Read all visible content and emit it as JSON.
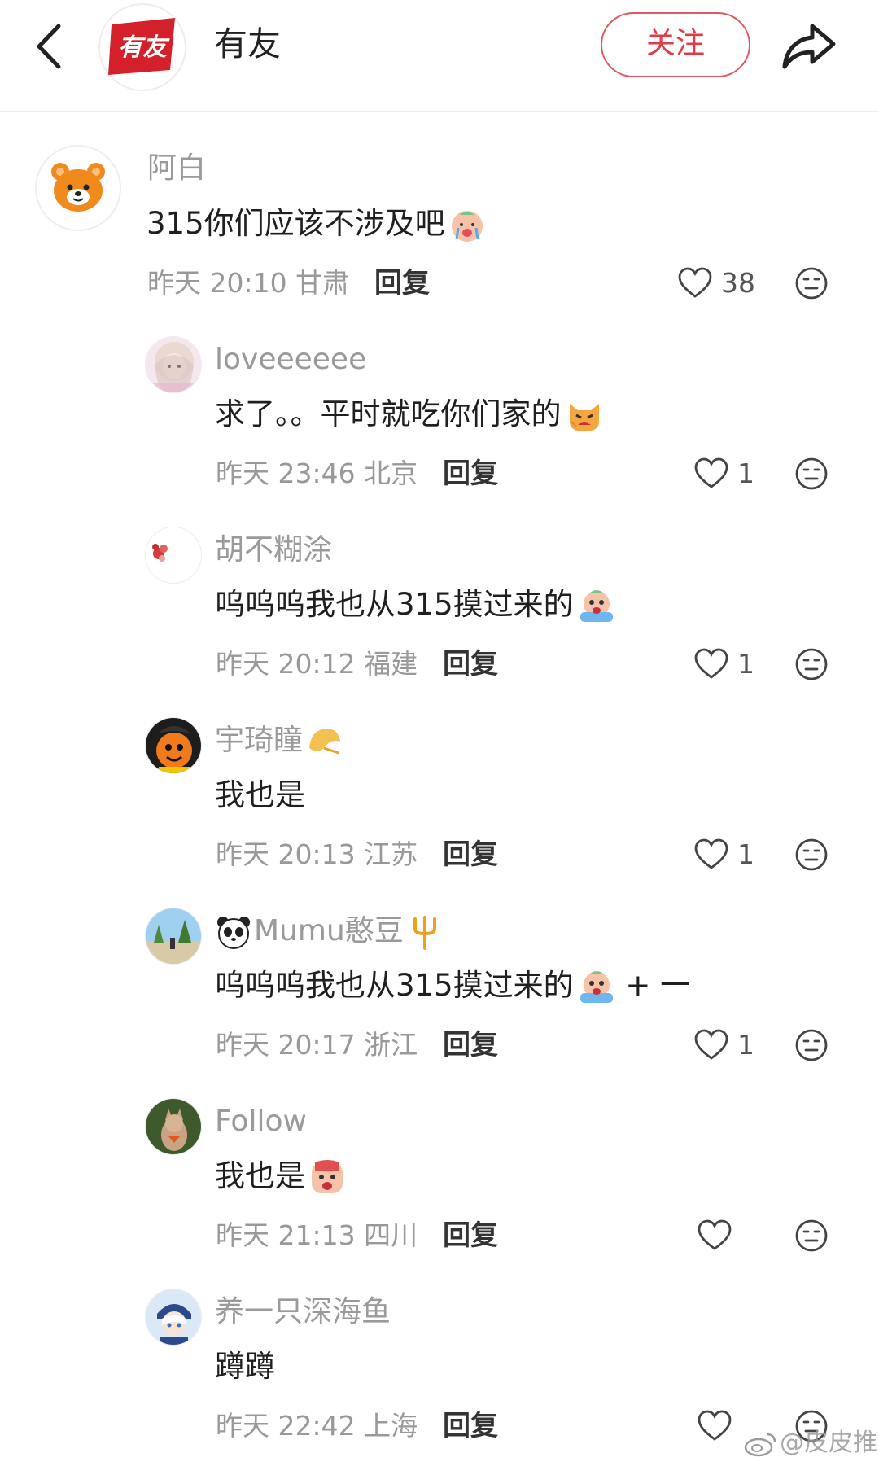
{
  "header": {
    "title": "有友",
    "follow_label": "关注",
    "logo_text": "有友"
  },
  "comments": [
    {
      "user": "阿白",
      "text": "315你们应该不涉及吧",
      "time": "昨天 20:10 甘肃",
      "reply": "回复",
      "likes": "38",
      "emoji": "crying-baby-emoji"
    },
    {
      "user": "loveeeeee",
      "text": "求了。。平时就吃你们家的",
      "time": "昨天 23:46 北京",
      "reply": "回复",
      "likes": "1",
      "emoji": "angry-cat-emoji"
    },
    {
      "user": "胡不糊涂",
      "text": "呜呜呜我也从315摸过来的",
      "time": "昨天 20:12 福建",
      "reply": "回复",
      "likes": "1",
      "emoji": "crying-face-emoji"
    },
    {
      "user": "宇琦瞳",
      "text": "我也是",
      "time": "昨天 20:13 江苏",
      "reply": "回复",
      "likes": "1",
      "emoji": "fortune-cookie-emoji"
    },
    {
      "user": "Mumu憨豆",
      "text": "呜呜呜我也从315摸过来的",
      "text_suffix": " + 一",
      "time": "昨天 20:17 浙江",
      "reply": "回复",
      "likes": "1",
      "emoji": "crying-face-emoji"
    },
    {
      "user": "Follow",
      "text": "我也是",
      "time": "昨天 21:13 四川",
      "reply": "回复",
      "likes": "",
      "emoji": "shocked-face-emoji"
    },
    {
      "user": "养一只深海鱼",
      "text": "蹲蹲",
      "time": "昨天 22:42 上海",
      "reply": "回复",
      "likes": ""
    }
  ],
  "watermark": "@皮皮推",
  "colors": {
    "accent": "#e03c46",
    "meta": "#999999",
    "username": "#9a9a9a"
  }
}
